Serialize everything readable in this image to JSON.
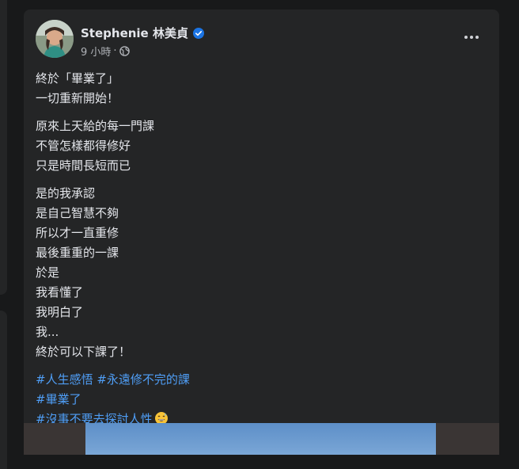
{
  "post": {
    "author": "Stephenie 林美貞",
    "time": "9 小時",
    "dot": "·",
    "paragraphs": [
      [
        "終於「畢業了」",
        "一切重新開始！"
      ],
      [
        "原來上天給的每一門課",
        "不管怎樣都得修好",
        "只是時間長短而已"
      ],
      [
        "是的我承認",
        "是自己智慧不夠",
        "所以才一直重修",
        "最後重重的一課",
        "於是",
        "我看懂了",
        "我明白了",
        "我...",
        "終於可以下課了！"
      ]
    ],
    "hashtags": {
      "life_insight": "#人生感悟",
      "never_ending_course": "#永遠修不完的課",
      "graduated": "#畢業了",
      "dont_discuss_humanity": "#沒事不要去探討人性"
    }
  },
  "icons": {
    "verified": "verified-badge-icon",
    "privacy": "globe-icon",
    "more": "more-options-icon",
    "emoji": "sweat-smile-emoji"
  },
  "colors": {
    "background": "#18191a",
    "card": "#242526",
    "text_primary": "#e4e6eb",
    "text_secondary": "#b0b3b8",
    "link": "#4f9ef6",
    "verified": "#1b74e4"
  }
}
